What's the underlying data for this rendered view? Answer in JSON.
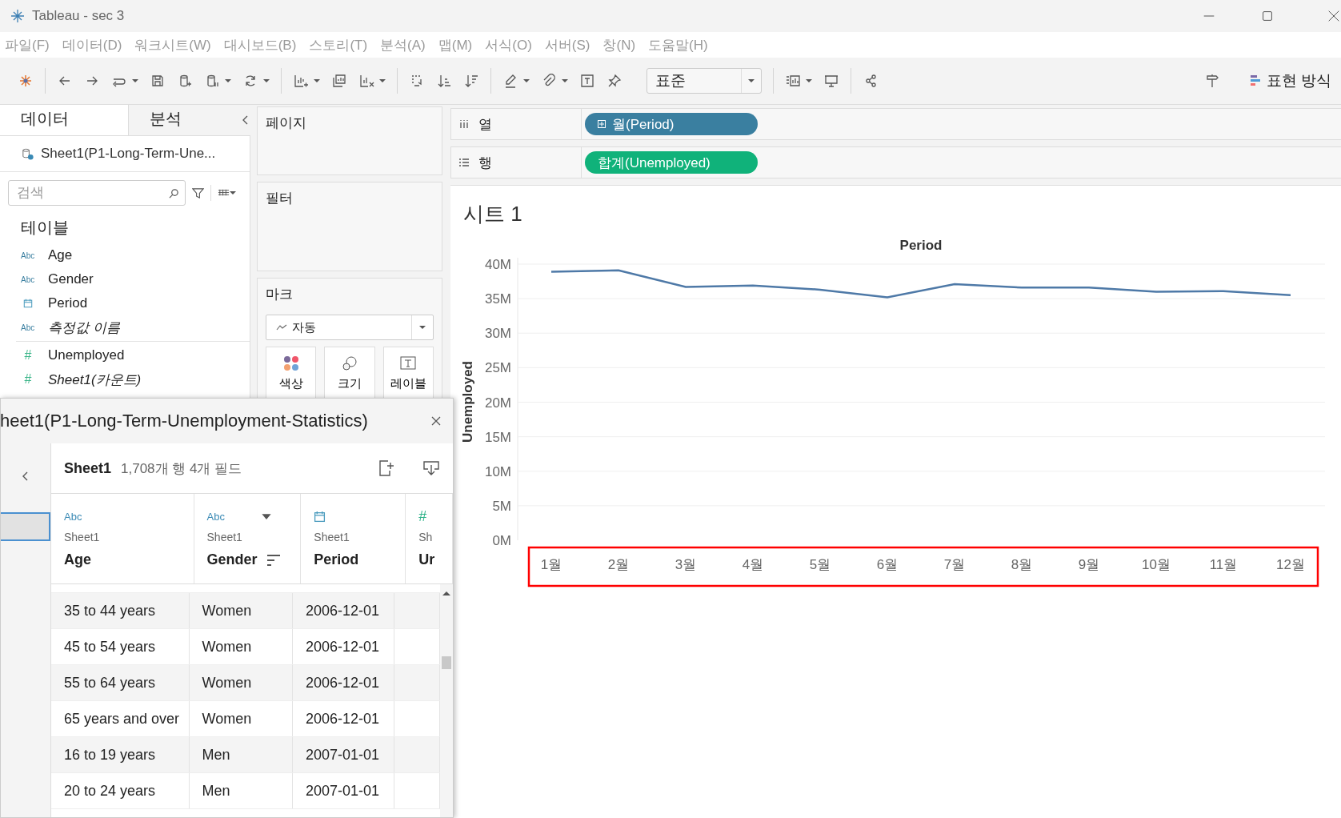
{
  "window": {
    "title": "Tableau - sec 3"
  },
  "menu": [
    "파일(F)",
    "데이터(D)",
    "워크시트(W)",
    "대시보드(B)",
    "스토리(T)",
    "분석(A)",
    "맵(M)",
    "서식(O)",
    "서버(S)",
    "창(N)",
    "도움말(H)"
  ],
  "toolbar": {
    "dropdown": "표준",
    "show_me": "표현 방식"
  },
  "data_pane": {
    "tabs": [
      {
        "label": "데이터",
        "selected": true
      },
      {
        "label": "분석",
        "selected": false
      }
    ],
    "source": "Sheet1(P1-Long-Term-Une...",
    "search": {
      "placeholder": "검색"
    },
    "section": "테이블",
    "fields": [
      {
        "name": "Age",
        "kind": "string",
        "type_label": "Abc",
        "generated": false
      },
      {
        "name": "Gender",
        "kind": "string",
        "type_label": "Abc",
        "generated": false
      },
      {
        "name": "Period",
        "kind": "date",
        "generated": false
      },
      {
        "name": "측정값 이름",
        "kind": "string",
        "type_label": "Abc",
        "generated": true
      },
      {
        "name": "Unemployed",
        "kind": "number",
        "type_label": "#",
        "generated": false
      },
      {
        "name": "Sheet1(카운트)",
        "kind": "number",
        "type_label": "#",
        "generated": true
      }
    ]
  },
  "cards": {
    "pages": "페이지",
    "filters": "필터",
    "marks": {
      "title": "마크",
      "mark_type": "자동",
      "buttons": [
        {
          "label": "색상",
          "kind": "color"
        },
        {
          "label": "크기",
          "kind": "size"
        },
        {
          "label": "레이블",
          "kind": "label"
        }
      ]
    }
  },
  "shelves": [
    {
      "label": "열",
      "kind": "columns",
      "pill": {
        "text": "월(Period)",
        "kind": "discrete"
      }
    },
    {
      "label": "행",
      "kind": "rows",
      "pill": {
        "text": "합계(Unemployed)",
        "kind": "continuous"
      }
    }
  ],
  "view": {
    "title": "시트 1",
    "chart_data": {
      "type": "line",
      "title": "Period",
      "ylabel": "Unemployed",
      "categories": [
        "1월",
        "2월",
        "3월",
        "4월",
        "5월",
        "6월",
        "7월",
        "8월",
        "9월",
        "10월",
        "11월",
        "12월"
      ],
      "series": [
        {
          "color": "#4e79a7",
          "values": [
            38900000,
            39100000,
            36700000,
            36900000,
            36300000,
            35200000,
            37100000,
            36600000,
            36600000,
            36000000,
            36100000,
            35500000
          ]
        }
      ],
      "ylim": [
        0,
        40000000
      ],
      "yticks": [
        {
          "value": 0,
          "label": "0M"
        },
        {
          "value": 5000000,
          "label": "5M"
        },
        {
          "value": 10000000,
          "label": "10M"
        },
        {
          "value": 15000000,
          "label": "15M"
        },
        {
          "value": 20000000,
          "label": "20M"
        },
        {
          "value": 25000000,
          "label": "25M"
        },
        {
          "value": 30000000,
          "label": "30M"
        },
        {
          "value": 35000000,
          "label": "35M"
        },
        {
          "value": 40000000,
          "label": "40M"
        }
      ],
      "grid": true
    },
    "highlight_x_axis": true
  },
  "data_popup": {
    "title": "heet1(P1-Long-Term-Unemployment-Statistics)",
    "table_name": "Sheet1",
    "summary": "1,708개 행 4개 필드",
    "columns": [
      {
        "kind": "string",
        "type_label": "Abc",
        "source": "Sheet1",
        "name": "Age",
        "hovered": false
      },
      {
        "kind": "string",
        "type_label": "Abc",
        "source": "Sheet1",
        "name": "Gender",
        "hovered": true
      },
      {
        "kind": "date",
        "source": "Sheet1",
        "name": "Period",
        "hovered": false
      },
      {
        "kind": "number",
        "type_label": "#",
        "source": "Sh",
        "name": "Ur",
        "hovered": false
      }
    ],
    "rows": [
      [
        "35 to 44 years",
        "Women",
        "2006-12-01"
      ],
      [
        "45 to 54 years",
        "Women",
        "2006-12-01"
      ],
      [
        "55 to 64 years",
        "Women",
        "2006-12-01"
      ],
      [
        "65 years and over",
        "Women",
        "2006-12-01"
      ],
      [
        "16 to 19 years",
        "Men",
        "2007-01-01"
      ],
      [
        "20 to 24 years",
        "Men",
        "2007-01-01"
      ]
    ]
  }
}
